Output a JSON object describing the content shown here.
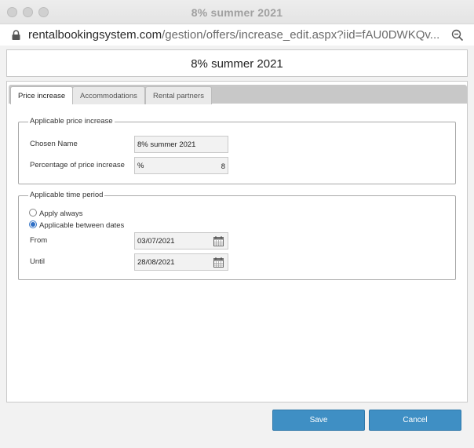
{
  "window": {
    "title": "8% summer 2021"
  },
  "urlbar": {
    "domain": "rentalbookingsystem.com",
    "path": "/gestion/offers/increase_edit.aspx?iid=fAU0DWKQv..."
  },
  "icons": {
    "lock": "lock-icon",
    "zoom": "zoom-out-icon",
    "calendar": "calendar-icon"
  },
  "page": {
    "title": "8% summer 2021"
  },
  "tabs": [
    {
      "label": "Price increase",
      "active": true
    },
    {
      "label": "Accommodations",
      "active": false
    },
    {
      "label": "Rental partners",
      "active": false
    }
  ],
  "price_group": {
    "legend": "Applicable price increase",
    "name_label": "Chosen Name",
    "name_value": "8% summer 2021",
    "pct_label": "Percentage of price increase",
    "pct_unit": "%",
    "pct_value": "8"
  },
  "time_group": {
    "legend": "Applicable time period",
    "option_always": "Apply always",
    "option_between": "Applicable between dates",
    "selected": "between",
    "from_label": "From",
    "from_value": "03/07/2021",
    "until_label": "Until",
    "until_value": "28/08/2021"
  },
  "buttons": {
    "save": "Save",
    "cancel": "Cancel"
  },
  "colors": {
    "button": "#3f8fc4",
    "tab_strip": "#c8c8c8",
    "radio_selected": "#2f6fc6"
  }
}
